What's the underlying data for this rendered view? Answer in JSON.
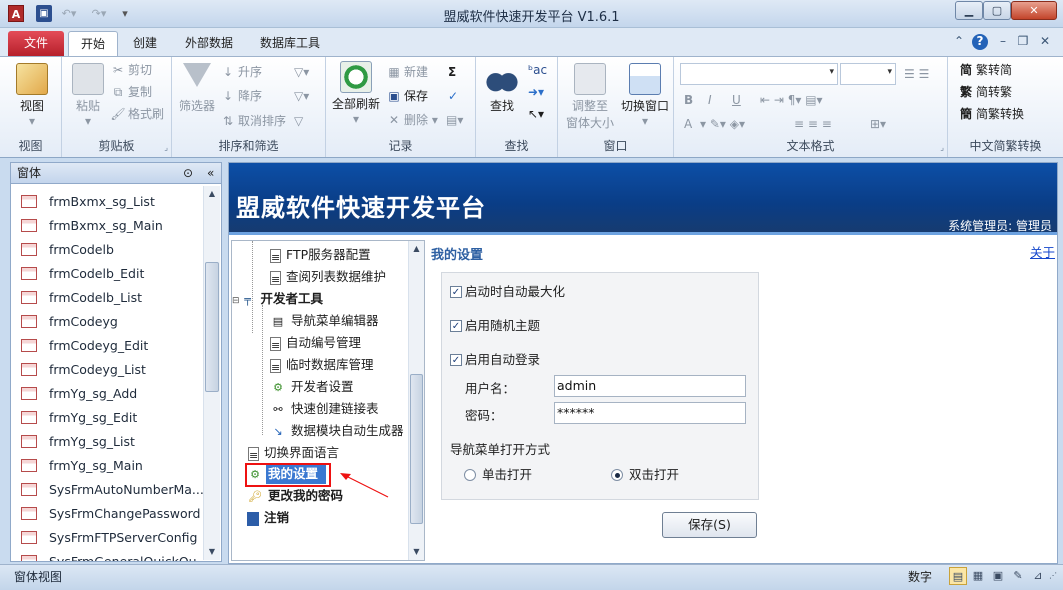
{
  "titlebar": {
    "title": "盟威软件快速开发平台 V1.6.1",
    "app_icon": "A",
    "icons": [
      "access-app-icon",
      "save-icon",
      "undo-icon",
      "redo-icon",
      "customize-toolbar-icon"
    ]
  },
  "tabs": [
    {
      "label": "文件"
    },
    {
      "label": "开始"
    },
    {
      "label": "创建"
    },
    {
      "label": "外部数据"
    },
    {
      "label": "数据库工具"
    }
  ],
  "ribbon": {
    "view": {
      "label": "视图",
      "group": "视图"
    },
    "clipboard": {
      "paste": "粘贴",
      "cut": "剪切",
      "copy": "复制",
      "format_painter": "格式刷",
      "group": "剪贴板"
    },
    "sort_filter": {
      "filter": "筛选器",
      "ascending": "升序",
      "descending": "降序",
      "clear_sort": "取消排序",
      "group": "排序和筛选"
    },
    "records": {
      "refresh_all": "全部刷新",
      "new": "新建",
      "save": "保存",
      "delete": "删除",
      "sum_icon": "Σ",
      "group": "记录"
    },
    "find": {
      "find": "查找",
      "group": "查找"
    },
    "window": {
      "fit_line1": "调整至",
      "fit_line2": "窗体大小",
      "switch": "切换窗口",
      "group": "窗口"
    },
    "text_format": {
      "bold": "B",
      "italic": "I",
      "underline": "U",
      "font_color": "A",
      "group": "文本格式"
    },
    "chinese_conversion": {
      "trad_to_simp": "繁转简",
      "simp_to_trad": "简转繁",
      "simp_trad_conv": "简繁转换",
      "group": "中文简繁转换"
    }
  },
  "nav": {
    "header": "窗体",
    "items": [
      "frmBxmx_sg_List",
      "frmBxmx_sg_Main",
      "frmCodelb",
      "frmCodelb_Edit",
      "frmCodelb_List",
      "frmCodeyg",
      "frmCodeyg_Edit",
      "frmCodeyg_List",
      "frmYg_sg_Add",
      "frmYg_sg_Edit",
      "frmYg_sg_List",
      "frmYg_sg_Main",
      "SysFrmAutoNumberMa...",
      "SysFrmChangePassword",
      "SysFrmFTPServerConfig",
      "SysFrmGeneralQuickQu..."
    ]
  },
  "form": {
    "brand": "盟威软件快速开发平台",
    "user_info": "系统管理员: 管理员",
    "about": "关于",
    "tree": [
      {
        "label": "FTP服务器配置"
      },
      {
        "label": "查阅列表数据维护"
      },
      {
        "label": "开发者工具"
      },
      {
        "label": "导航菜单编辑器"
      },
      {
        "label": "自动编号管理"
      },
      {
        "label": "临时数据库管理"
      },
      {
        "label": "开发者设置"
      },
      {
        "label": "快速创建链接表"
      },
      {
        "label": "数据模块自动生成器"
      },
      {
        "label": "切换界面语言"
      },
      {
        "label": "我的设置"
      },
      {
        "label": "更改我的密码"
      },
      {
        "label": "注销"
      }
    ],
    "settings": {
      "title": "我的设置",
      "maximize_on_start": "启动时自动最大化",
      "random_theme": "启用随机主题",
      "auto_login": "启用自动登录",
      "username_label": "用户名：",
      "username": "admin",
      "password_label": "密码：",
      "password": "******",
      "nav_open_mode_label": "导航菜单打开方式",
      "single_click": "单击打开",
      "double_click": "双击打开",
      "selected_mode": "双击打开",
      "save_button": "保存(S)"
    }
  },
  "status": {
    "text": "窗体视图",
    "numlock": "数字"
  },
  "colors": {
    "header_blue": "#0d4fa7",
    "file_tab_red": "#c8232f",
    "highlight_red": "#ee1111",
    "selection_blue": "#3a78d1"
  }
}
